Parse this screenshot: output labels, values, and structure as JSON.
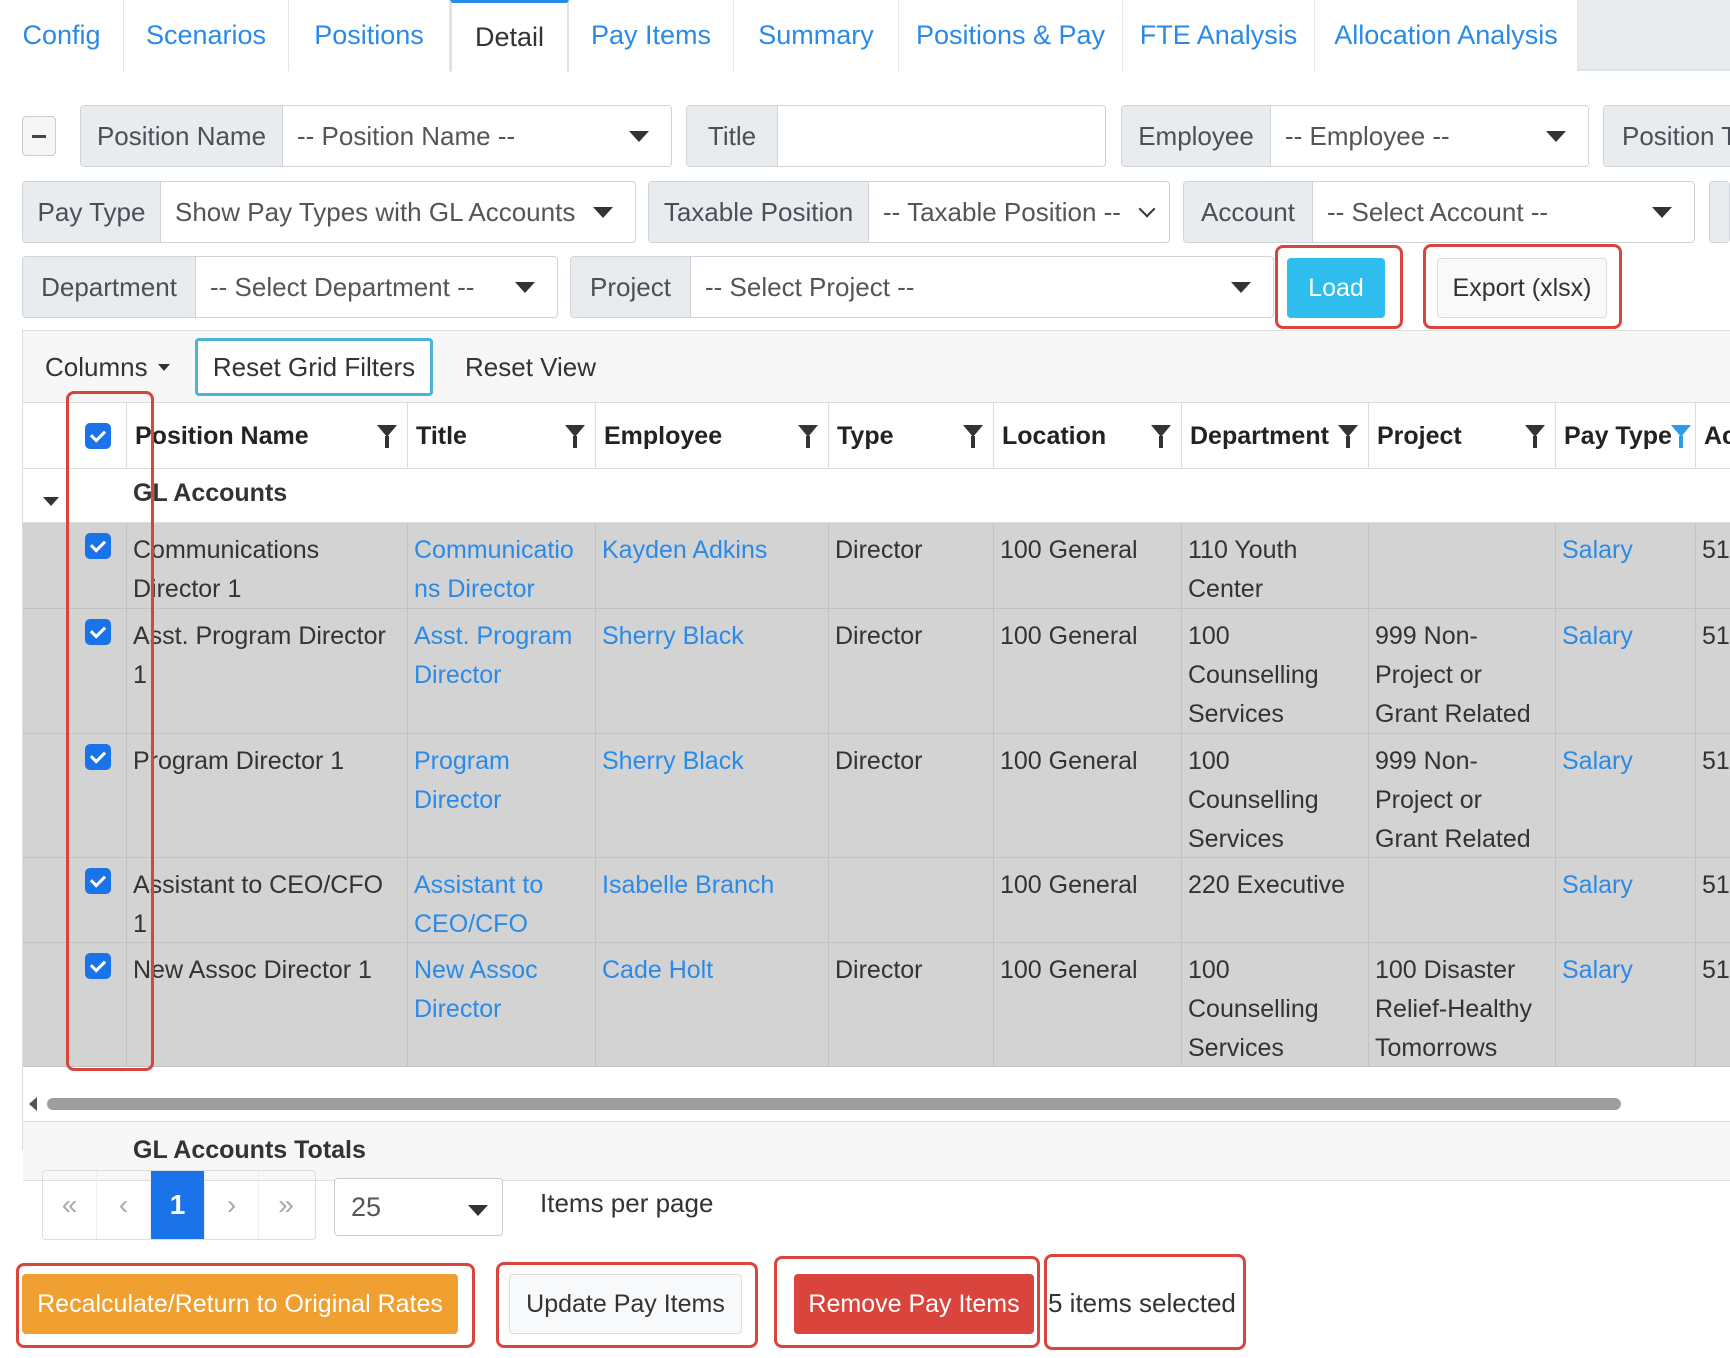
{
  "tabs": [
    {
      "label": "Config"
    },
    {
      "label": "Scenarios"
    },
    {
      "label": "Positions"
    },
    {
      "label": "Detail"
    },
    {
      "label": "Pay Items"
    },
    {
      "label": "Summary"
    },
    {
      "label": "Positions & Pay"
    },
    {
      "label": "FTE Analysis"
    },
    {
      "label": "Allocation Analysis"
    }
  ],
  "filters": {
    "position_name": {
      "label": "Position Name",
      "value": "-- Position Name --"
    },
    "title": {
      "label": "Title",
      "value": ""
    },
    "employee": {
      "label": "Employee",
      "value": "-- Employee --"
    },
    "position_type": {
      "label": "Position T"
    },
    "pay_type": {
      "label": "Pay Type",
      "value": "Show Pay Types with GL Accounts"
    },
    "taxable_position": {
      "label": "Taxable Position",
      "value": "-- Taxable Position --"
    },
    "account": {
      "label": "Account",
      "value": "-- Select Account --"
    },
    "department": {
      "label": "Department",
      "value": "-- Select Department --"
    },
    "project": {
      "label": "Project",
      "value": "-- Select Project --"
    }
  },
  "buttons": {
    "load": "Load",
    "export": "Export (xlsx)",
    "recalculate": "Recalculate/Return to Original Rates",
    "update": "Update Pay Items",
    "remove": "Remove Pay Items"
  },
  "grid": {
    "toolbar": {
      "columns": "Columns",
      "reset_filters": "Reset Grid Filters",
      "reset_view": "Reset View"
    },
    "columns": [
      "Position Name",
      "Title",
      "Employee",
      "Type",
      "Location",
      "Department",
      "Project",
      "Pay Type",
      "Ac"
    ],
    "group_label": "GL Accounts",
    "rows": [
      {
        "position": "Communications Director 1",
        "title": "Communicatio ns Director",
        "employee": "Kayden Adkins",
        "type": "Director",
        "location": "100 General",
        "department": "110 Youth Center",
        "project": "",
        "pay_type": "Salary",
        "account": "51"
      },
      {
        "position": "Asst. Program Director 1",
        "title": "Asst. Program Director",
        "employee": "Sherry Black",
        "type": "Director",
        "location": "100 General",
        "department": "100 Counselling Services",
        "project": "999 Non-Project or Grant Related",
        "pay_type": "Salary",
        "account": "51"
      },
      {
        "position": "Program Director 1",
        "title": "Program Director",
        "employee": "Sherry Black",
        "type": "Director",
        "location": "100 General",
        "department": "100 Counselling Services",
        "project": "999 Non-Project or Grant Related",
        "pay_type": "Salary",
        "account": "51"
      },
      {
        "position": "Assistant to CEO/CFO 1",
        "title": "Assistant to CEO/CFO",
        "employee": "Isabelle Branch",
        "type": "",
        "location": "100 General",
        "department": "220 Executive",
        "project": "",
        "pay_type": "Salary",
        "account": "51"
      },
      {
        "position": "New Assoc Director 1",
        "title": "New Assoc Director",
        "employee": "Cade Holt",
        "type": "Director",
        "location": "100 General",
        "department": "100 Counselling Services",
        "project": "100 Disaster Relief-Healthy Tomorrows",
        "pay_type": "Salary",
        "account": "51"
      }
    ],
    "totals_label": "GL Accounts Totals"
  },
  "pager": {
    "first": "«",
    "prev": "‹",
    "current": "1",
    "next": "›",
    "last": "»",
    "page_size": "25",
    "per_page_label": "Items per page"
  },
  "selection_text": "5 items selected",
  "colors": {
    "accent": "#2a8ae8",
    "load": "#2ebdee",
    "recalc": "#f0a030",
    "remove": "#d9453d",
    "highlight": "#d9453d"
  }
}
